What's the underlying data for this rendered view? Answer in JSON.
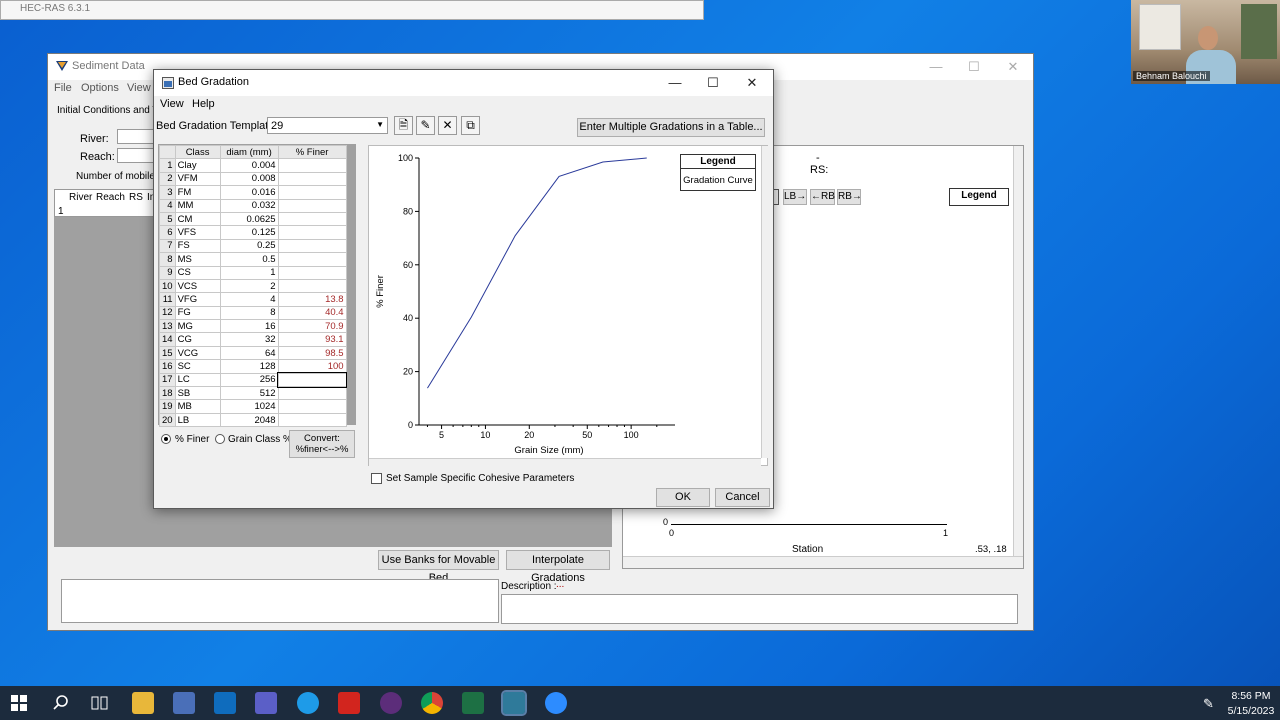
{
  "hecras": {
    "title": "HEC-RAS 6.3.1"
  },
  "sediment": {
    "title": "Sediment Data",
    "menu": [
      "File",
      "Options",
      "View"
    ],
    "tab_label": "Initial Conditions and Tr",
    "river_label": "River:",
    "reach_label": "Reach:",
    "mobile_label": "Number of mobile b",
    "table_headers": [
      "River",
      "Reach",
      "RS",
      "In"
    ],
    "row_number": "1",
    "rs_label": "RS:",
    "rs_dash": "-",
    "bank_buttons": [
      "LB→",
      "←RB",
      "RB→"
    ],
    "legend_title": "Legend",
    "station_label": "Station",
    "axis_zero_y": "0",
    "axis_zero_x": "0",
    "axis_one_x": "1",
    "coords": ".53, .18",
    "use_banks_btn": "Use Banks for Movable Bed",
    "interp_btn": "Interpolate Gradations",
    "description_label": "Description :",
    "description_dots": "..."
  },
  "dialog": {
    "title": "Bed Gradation",
    "menu": [
      "View",
      "Help"
    ],
    "template_label": "Bed Gradation Template:",
    "template_value": "29",
    "multi_btn": "Enter Multiple Gradations in a Table...",
    "table_headers": [
      "Class",
      "diam (mm)",
      "% Finer"
    ],
    "rows": [
      {
        "n": "1",
        "cls": "Clay",
        "diam": "0.004",
        "pct": ""
      },
      {
        "n": "2",
        "cls": "VFM",
        "diam": "0.008",
        "pct": ""
      },
      {
        "n": "3",
        "cls": "FM",
        "diam": "0.016",
        "pct": ""
      },
      {
        "n": "4",
        "cls": "MM",
        "diam": "0.032",
        "pct": ""
      },
      {
        "n": "5",
        "cls": "CM",
        "diam": "0.0625",
        "pct": ""
      },
      {
        "n": "6",
        "cls": "VFS",
        "diam": "0.125",
        "pct": ""
      },
      {
        "n": "7",
        "cls": "FS",
        "diam": "0.25",
        "pct": ""
      },
      {
        "n": "8",
        "cls": "MS",
        "diam": "0.5",
        "pct": ""
      },
      {
        "n": "9",
        "cls": "CS",
        "diam": "1",
        "pct": ""
      },
      {
        "n": "10",
        "cls": "VCS",
        "diam": "2",
        "pct": ""
      },
      {
        "n": "11",
        "cls": "VFG",
        "diam": "4",
        "pct": "13.8"
      },
      {
        "n": "12",
        "cls": "FG",
        "diam": "8",
        "pct": "40.4"
      },
      {
        "n": "13",
        "cls": "MG",
        "diam": "16",
        "pct": "70.9"
      },
      {
        "n": "14",
        "cls": "CG",
        "diam": "32",
        "pct": "93.1"
      },
      {
        "n": "15",
        "cls": "VCG",
        "diam": "64",
        "pct": "98.5"
      },
      {
        "n": "16",
        "cls": "SC",
        "diam": "128",
        "pct": "100"
      },
      {
        "n": "17",
        "cls": "LC",
        "diam": "256",
        "pct": ""
      },
      {
        "n": "18",
        "cls": "SB",
        "diam": "512",
        "pct": ""
      },
      {
        "n": "19",
        "cls": "MB",
        "diam": "1024",
        "pct": ""
      },
      {
        "n": "20",
        "cls": "LB",
        "diam": "2048",
        "pct": ""
      }
    ],
    "radio_finer": "% Finer",
    "radio_class": "Grain Class %",
    "convert_btn_1": "Convert:",
    "convert_btn_2": "%finer<-->%",
    "cohesive_label": "Set Sample Specific Cohesive Parameters",
    "ok_btn": "OK",
    "cancel_btn": "Cancel",
    "legend_title": "Legend",
    "legend_entry": "Gradation Curve"
  },
  "chart_data": {
    "type": "line",
    "xlabel": "Grain Size (mm)",
    "ylabel": "% Finer",
    "xscale": "log",
    "xlim": [
      3.5,
      200
    ],
    "ylim": [
      0,
      100
    ],
    "xticks": [
      5,
      10,
      20,
      50,
      100
    ],
    "yticks": [
      0,
      20,
      40,
      60,
      80,
      100
    ],
    "series": [
      {
        "x": [
          4,
          8,
          16,
          32,
          64,
          128
        ],
        "y": [
          13.8,
          40.4,
          70.9,
          93.1,
          98.5,
          100
        ]
      }
    ],
    "color": "#2a3a9a"
  },
  "taskbar": {
    "time": "8:56 PM",
    "date": "5/15/2023"
  },
  "video": {
    "name": "Behnam Balouchi"
  }
}
